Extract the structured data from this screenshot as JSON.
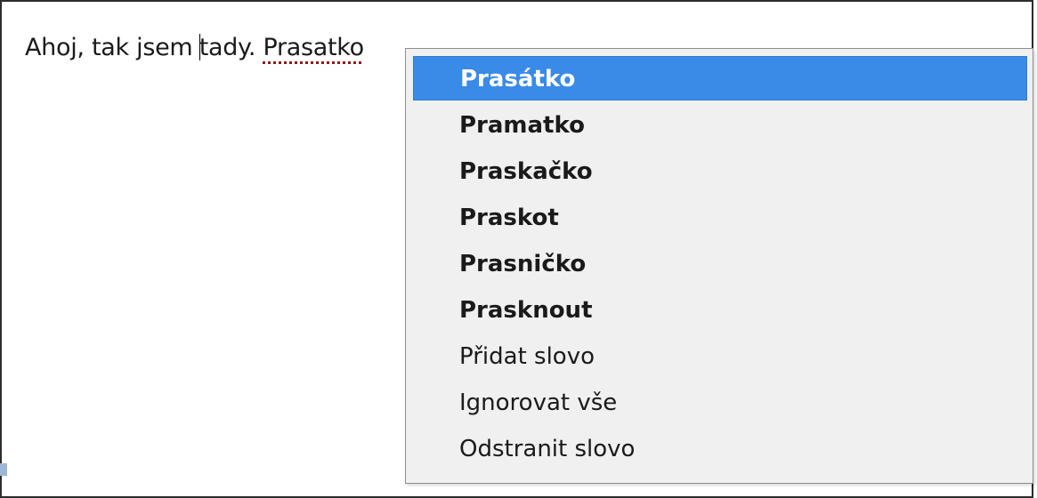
{
  "editor": {
    "text_before_caret": "Ahoj, tak jsem ",
    "text_after_caret": "tady. ",
    "misspelled_word": "Prasatko"
  },
  "context_menu": {
    "suggestions": [
      {
        "label": "Prasátko",
        "highlighted": true
      },
      {
        "label": "Pramatko",
        "highlighted": false
      },
      {
        "label": "Praskačko",
        "highlighted": false
      },
      {
        "label": "Praskot",
        "highlighted": false
      },
      {
        "label": "Prasničko",
        "highlighted": false
      },
      {
        "label": "Prasknout",
        "highlighted": false
      }
    ],
    "actions": [
      {
        "label": "Přidat slovo"
      },
      {
        "label": "Ignorovat vše"
      },
      {
        "label": "Odstranit slovo"
      }
    ]
  },
  "colors": {
    "highlight": "#3a8ae8",
    "menu_background": "#f0f0f0",
    "spell_underline": "#8b1a1a"
  }
}
